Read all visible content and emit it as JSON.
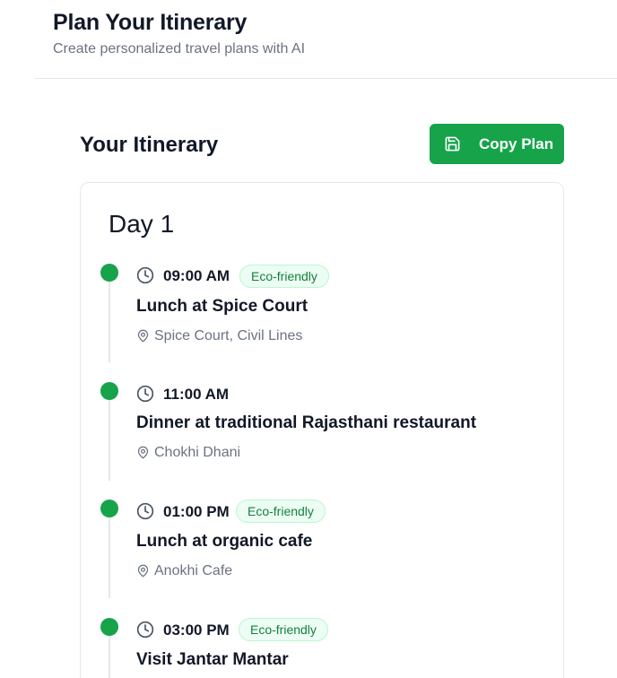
{
  "header": {
    "title": "Plan Your Itinerary",
    "subtitle": "Create personalized travel plans with AI"
  },
  "itinerary": {
    "title": "Your Itinerary",
    "copy_button_label": "Copy Plan",
    "days": [
      {
        "title": "Day 1",
        "items": [
          {
            "time": "09:00 AM",
            "badge": "Eco-friendly",
            "activity": "Lunch at Spice Court",
            "location": "Spice Court, Civil Lines"
          },
          {
            "time": "11:00 AM",
            "badge": "",
            "activity": "Dinner at traditional Rajasthani restaurant",
            "location": "Chokhi Dhani"
          },
          {
            "time": "01:00 PM",
            "badge": "Eco-friendly",
            "activity": "Lunch at organic cafe",
            "location": "Anokhi Cafe"
          },
          {
            "time": "03:00 PM",
            "badge": "Eco-friendly",
            "activity": "Visit Jantar Mantar",
            "location": ""
          }
        ]
      }
    ]
  },
  "colors": {
    "accent": "#16a34a",
    "badge_bg": "#ecfdf3",
    "badge_border": "#bbf7d0",
    "badge_text": "#15803d",
    "muted_text": "#6b7280"
  },
  "icons": {
    "copy_button": "save-icon",
    "time": "clock-icon",
    "location": "map-pin-icon"
  }
}
